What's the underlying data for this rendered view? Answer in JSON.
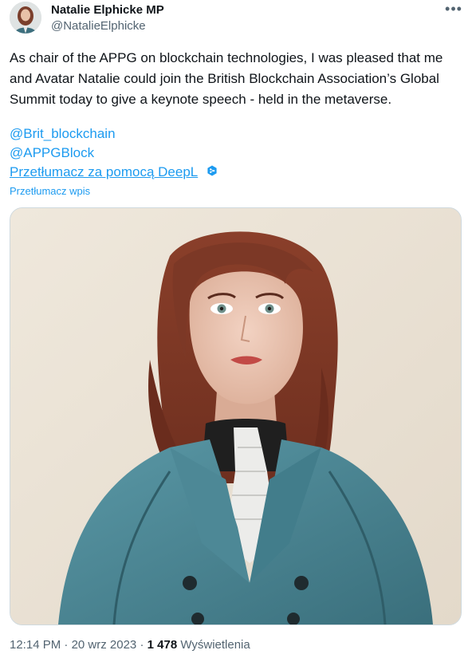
{
  "author": {
    "name": "Natalie Elphicke MP",
    "handle": "@NatalieElphicke"
  },
  "tweet": {
    "text": "As chair of the APPG on blockchain technologies, I was pleased that me and Avatar Natalie could join the British Blockchain Association’s Global Summit today to give a keynote speech - held in the metaverse.",
    "mentions": [
      "@Brit_blockchain",
      "@APPGBlock"
    ],
    "translated_by": "Przetłumacz za pomocą DeepL",
    "translate_post": "Przetłumacz wpis"
  },
  "meta": {
    "time": "12:14 PM",
    "date": "20 wrz 2023",
    "views": "1 478",
    "views_label": "Wyświetlenia"
  },
  "icons": {
    "more": "more-horizontal-icon",
    "deepl": "deepl-icon"
  },
  "colors": {
    "link": "#1d9bf0",
    "secondary_text": "#536471",
    "primary_text": "#0f1419"
  }
}
